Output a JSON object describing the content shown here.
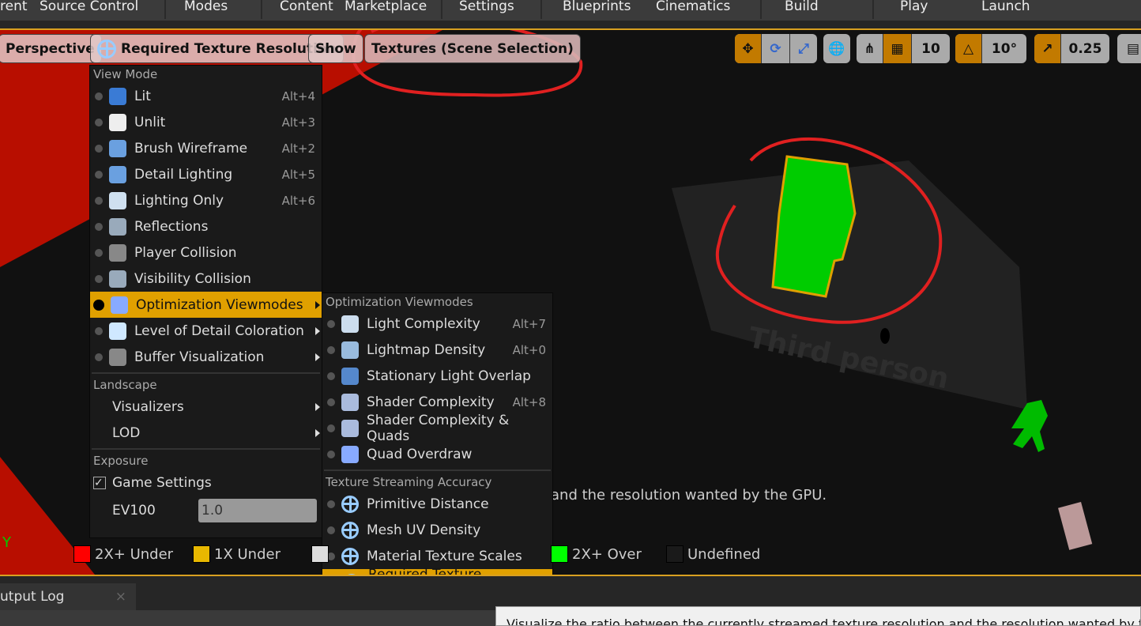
{
  "menubar": {
    "items": [
      "rent",
      "Source Control",
      "Modes",
      "Content",
      "Marketplace",
      "Settings",
      "Blueprints",
      "Cinematics",
      "Build",
      "Play",
      "Launch"
    ]
  },
  "toolbar": {
    "perspective": "Perspective",
    "viewmode": "Required Texture Resolution",
    "show": "Show",
    "textures": "Textures (Scene Selection)",
    "grid_snap": "10",
    "rot_snap": "10°",
    "scale_snap": "0.25"
  },
  "menu": {
    "view_mode_header": "View Mode",
    "items": [
      {
        "label": "Lit",
        "shortcut": "Alt+4",
        "icon": "lit-cube-icon",
        "color": "#3a7bd5"
      },
      {
        "label": "Unlit",
        "shortcut": "Alt+3",
        "icon": "unlit-shield-icon",
        "color": "#eeeeee"
      },
      {
        "label": "Brush Wireframe",
        "shortcut": "Alt+2",
        "icon": "wireframe-cube-icon",
        "color": "#6aa0e0"
      },
      {
        "label": "Detail Lighting",
        "shortcut": "Alt+5",
        "icon": "detail-lighting-icon",
        "color": "#6aa0e0"
      },
      {
        "label": "Lighting Only",
        "shortcut": "Alt+6",
        "icon": "lighting-only-icon",
        "color": "#cfe0f0"
      },
      {
        "label": "Reflections",
        "shortcut": "",
        "icon": "reflections-sphere-icon",
        "color": "#9ab"
      },
      {
        "label": "Player Collision",
        "shortcut": "",
        "icon": "player-collision-icon",
        "color": "#888"
      },
      {
        "label": "Visibility Collision",
        "shortcut": "",
        "icon": "visibility-collision-icon",
        "color": "#9ab"
      },
      {
        "label": "Optimization Viewmodes",
        "shortcut": "",
        "icon": "optimization-grid-icon",
        "color": "#8af",
        "submenu": true,
        "selected": true
      },
      {
        "label": "Level of Detail Coloration",
        "shortcut": "",
        "icon": "lod-coloration-icon",
        "color": "#cfe8ff",
        "submenu": true
      },
      {
        "label": "Buffer Visualization",
        "shortcut": "",
        "icon": "buffer-visualization-icon",
        "color": "#888",
        "submenu": true
      }
    ],
    "landscape_header": "Landscape",
    "visualizers": "Visualizers",
    "lod": "LOD",
    "exposure_header": "Exposure",
    "game_settings": "Game Settings",
    "game_settings_checked": true,
    "ev100_label": "EV100",
    "ev100_value": "1.0"
  },
  "submenu": {
    "header1": "Optimization Viewmodes",
    "items1": [
      {
        "label": "Light Complexity",
        "shortcut": "Alt+7"
      },
      {
        "label": "Lightmap Density",
        "shortcut": "Alt+0"
      },
      {
        "label": "Stationary Light Overlap",
        "shortcut": ""
      },
      {
        "label": "Shader Complexity",
        "shortcut": "Alt+8"
      },
      {
        "label": "Shader Complexity & Quads",
        "shortcut": ""
      },
      {
        "label": "Quad Overdraw",
        "shortcut": ""
      }
    ],
    "header2": "Texture Streaming Accuracy",
    "items2": [
      {
        "label": "Primitive Distance"
      },
      {
        "label": "Mesh UV Density"
      },
      {
        "label": "Material Texture Scales"
      },
      {
        "label": "Required Texture Resolution",
        "selected": true
      }
    ]
  },
  "viewport": {
    "hint": "and the resolution wanted by the GPU.",
    "axis": "Y",
    "floor_text": "Third person"
  },
  "legend": [
    {
      "label": "2X+ Under",
      "color": "#ff0000"
    },
    {
      "label": "1X Under",
      "color": "#e8b800"
    },
    {
      "label": "",
      "color": "#dddddd"
    },
    {
      "label": "2X+ Over",
      "color": "#00ff00"
    },
    {
      "label": "Undefined",
      "color": "#1a1a1a"
    }
  ],
  "bottom": {
    "tab": "utput Log",
    "tooltip": "Visualize the ratio between the currently streamed texture resolution and the resolution wanted by the"
  },
  "colors": {
    "accent": "#e0a000",
    "annotation": "#e02020"
  }
}
